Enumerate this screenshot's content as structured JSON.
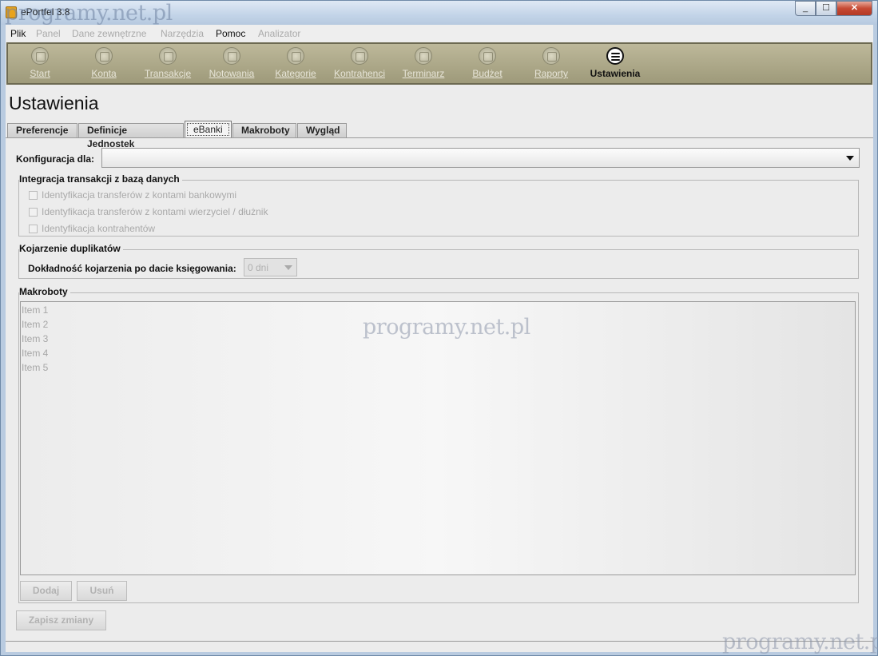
{
  "window": {
    "title": "ePortfel 3.8",
    "watermark": "programy.net.pl",
    "controls": {
      "minimize": "_",
      "maximize": "☐",
      "close": "✕"
    }
  },
  "menu": [
    {
      "label": "Plik",
      "enabled": true
    },
    {
      "label": "Panel",
      "enabled": false
    },
    {
      "label": "Dane zewnętrzne",
      "enabled": false
    },
    {
      "label": "Narzędzia",
      "enabled": false
    },
    {
      "label": "Pomoc",
      "enabled": true
    },
    {
      "label": "Analizator",
      "enabled": false
    }
  ],
  "toolbar": [
    {
      "label": "Start",
      "icon": "start-icon"
    },
    {
      "label": "Konta",
      "icon": "accounts-icon"
    },
    {
      "label": "Transakcje",
      "icon": "transactions-icon"
    },
    {
      "label": "Notowania",
      "icon": "quotes-icon"
    },
    {
      "label": "Kategorie",
      "icon": "categories-icon"
    },
    {
      "label": "Kontrahenci",
      "icon": "contractors-icon"
    },
    {
      "label": "Terminarz",
      "icon": "calendar-icon"
    },
    {
      "label": "Budżet",
      "icon": "budget-icon"
    },
    {
      "label": "Raporty",
      "icon": "reports-icon"
    },
    {
      "label": "Ustawienia",
      "icon": "settings-list-icon",
      "active": true
    }
  ],
  "page": {
    "title": "Ustawienia"
  },
  "tabs": [
    {
      "label": "Preferencje"
    },
    {
      "label": "Definicje Jednostek"
    },
    {
      "label": "eBanki",
      "selected": true
    },
    {
      "label": "Makroboty"
    },
    {
      "label": "Wygląd"
    }
  ],
  "config": {
    "label": "Konfiguracja dla:",
    "value": ""
  },
  "integration": {
    "title": "Integracja transakcji z bazą danych",
    "options": [
      "Identyfikacja transferów z kontami bankowymi",
      "Identyfikacja transferów z kontami wierzyciel / dłużnik",
      "Identyfikacja kontrahentów"
    ]
  },
  "duplicates": {
    "title": "Kojarzenie duplikatów",
    "label": "Dokładność kojarzenia po dacie księgowania:",
    "value": "0 dni"
  },
  "macrobots": {
    "title": "Makroboty",
    "items": [
      "Item 1",
      "Item 2",
      "Item 3",
      "Item 4",
      "Item 5"
    ],
    "add_label": "Dodaj",
    "remove_label": "Usuń"
  },
  "save_label": "Zapisz zmiany"
}
